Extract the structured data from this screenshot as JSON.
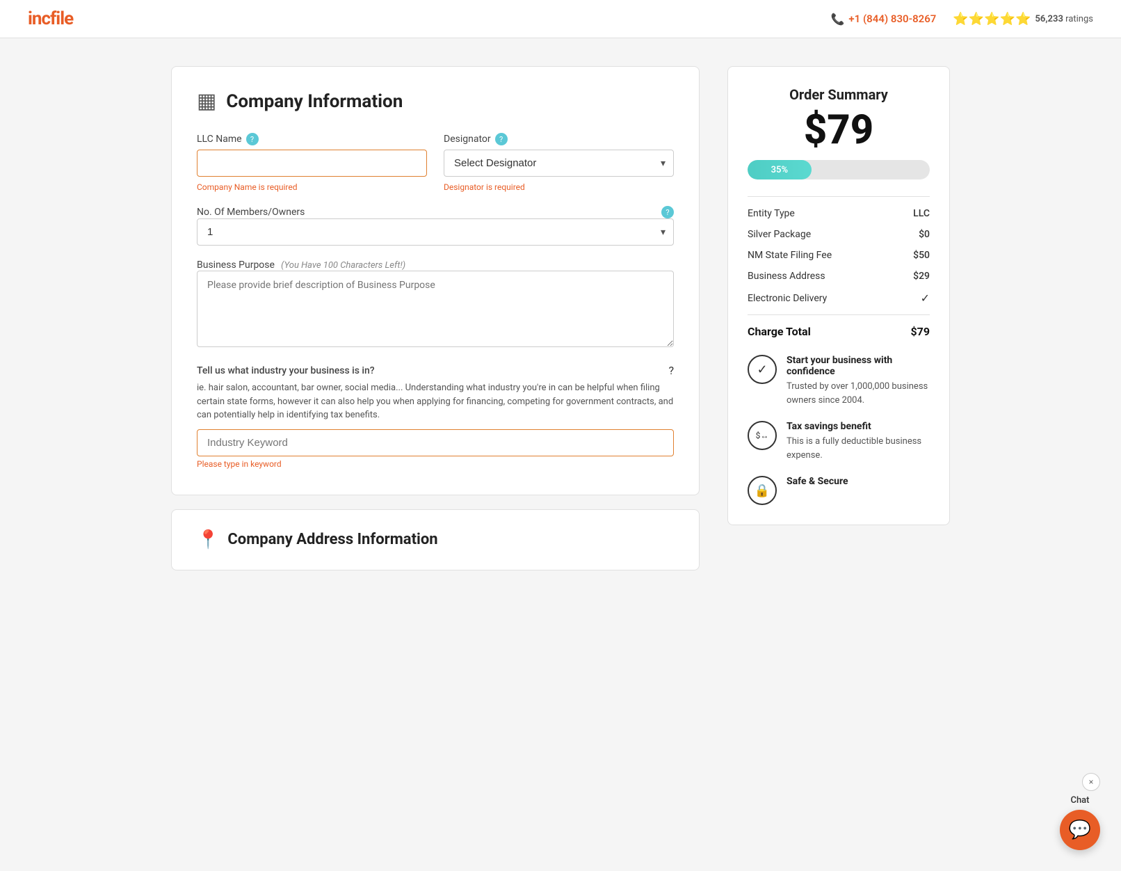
{
  "header": {
    "logo_text": "incfile",
    "phone": "+1 (844) 830-8267",
    "ratings_count": "56,233",
    "ratings_label": "ratings"
  },
  "company_info": {
    "section_title": "Company Information",
    "llc_name_label": "LLC Name",
    "llc_name_error": "Company Name is required",
    "llc_name_placeholder": "",
    "designator_label": "Designator",
    "designator_error": "Designator is required",
    "designator_placeholder": "Select Designator",
    "members_label": "No. Of Members/Owners",
    "members_value": "1",
    "business_purpose_label": "Business Purpose",
    "char_left_note": "You Have 100 Characters Left!",
    "business_purpose_placeholder": "Please provide brief description of Business Purpose",
    "industry_label": "Tell us what industry your business is in?",
    "industry_description": "ie. hair salon, accountant, bar owner, social media... Understanding what industry you're in can be helpful when filing certain state forms, however it can also help you when applying for financing, competing for government contracts, and can potentially help in identifying tax benefits.",
    "industry_placeholder": "Industry Keyword",
    "industry_error": "Please type in keyword"
  },
  "company_address": {
    "section_title": "Company Address Information"
  },
  "order_summary": {
    "title": "Order Summary",
    "price": "$79",
    "progress_percent": 35,
    "progress_label": "35%",
    "entity_type_label": "Entity Type",
    "entity_type_value": "LLC",
    "silver_package_label": "Silver Package",
    "silver_package_value": "$0",
    "state_filing_label": "NM State Filing Fee",
    "state_filing_value": "$50",
    "business_address_label": "Business Address",
    "business_address_value": "$29",
    "electronic_delivery_label": "Electronic Delivery",
    "electronic_delivery_value": "✓",
    "charge_total_label": "Charge Total",
    "charge_total_value": "$79"
  },
  "trust_items": [
    {
      "id": "confidence",
      "icon": "✓",
      "title": "Start your business with confidence",
      "description": "Trusted by over 1,000,000 business owners since 2004."
    },
    {
      "id": "tax",
      "icon": "$↔",
      "title": "Tax savings benefit",
      "description": "This is a fully deductible business expense."
    },
    {
      "id": "secure",
      "icon": "🔒",
      "title": "Safe & Secure",
      "description": ""
    }
  ],
  "chat": {
    "label": "Chat",
    "close_icon": "×"
  }
}
